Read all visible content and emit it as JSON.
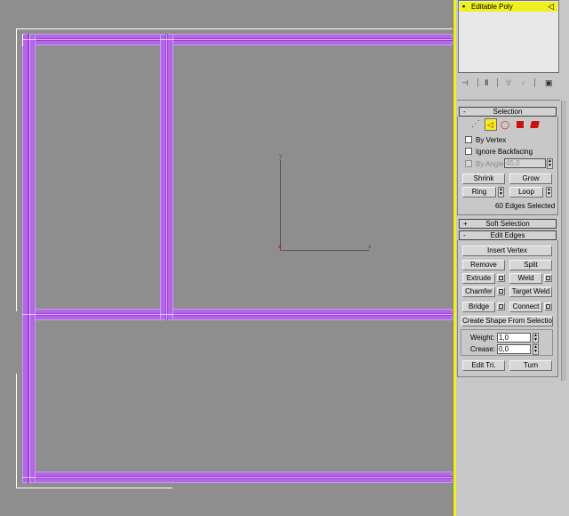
{
  "modifier_stack": {
    "item_label": "Editable Poly",
    "expand_glyph": "▪",
    "edge_glyph": "◁"
  },
  "stack_toolbar": {
    "pin_glyph": "⊣",
    "show_end_glyph": "Ⅱ",
    "make_unique_glyph": "∀",
    "remove_glyph": "♁",
    "configure_glyph": "▣"
  },
  "selection_rollout": {
    "minus": "-",
    "title": "Selection",
    "subobject_icons": {
      "vertex_glyph": "⋰",
      "edge_glyph": "◁",
      "border_glyph": "◯",
      "polygon_color": "#cc1010",
      "element_color": "#cc1010"
    },
    "by_vertex_label": "By Vertex",
    "ignore_backfacing_label": "Ignore Backfacing",
    "by_angle_label": "By Angle:",
    "by_angle_value": "45,0",
    "shrink_label": "Shrink",
    "grow_label": "Grow",
    "ring_label": "Ring",
    "loop_label": "Loop",
    "status_text": "60 Edges Selected"
  },
  "soft_selection_rollout": {
    "plus": "+",
    "title": "Soft Selection"
  },
  "edit_edges_rollout": {
    "minus": "-",
    "title": "Edit Edges",
    "insert_vertex_label": "Insert Vertex",
    "remove_label": "Remove",
    "split_label": "Split",
    "extrude_label": "Extrude",
    "weld_label": "Weld",
    "chamfer_label": "Chamfer",
    "target_weld_label": "Target Weld",
    "bridge_label": "Bridge",
    "connect_label": "Connect",
    "create_shape_label": "Create Shape From Selection",
    "weight_label": "Weight:",
    "weight_value": "1,0",
    "crease_label": "Crease:",
    "crease_value": "0,0",
    "edit_tri_label": "Edit Tri.",
    "turn_label": "Turn"
  },
  "gizmo": {
    "y_glyph": "y",
    "x_glyph": "x",
    "z_glyph": "z"
  },
  "spinner_glyphs": {
    "up": "▲",
    "down": "▼"
  },
  "colors": {
    "viewport_bg": "#8e8e8e",
    "panel_bg": "#c8c8c8",
    "active_yellow": "#f0f01c",
    "edge_selected": "#b565e8"
  }
}
